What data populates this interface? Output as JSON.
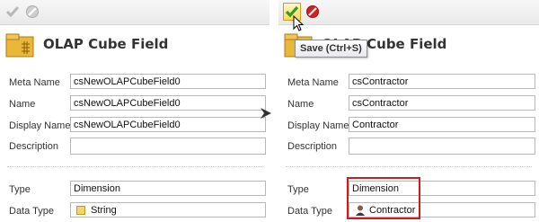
{
  "left": {
    "title": "OLAP Cube Field",
    "fields": [
      {
        "label": "Meta Name",
        "value": "csNewOLAPCubeField0"
      },
      {
        "label": "Name",
        "value": "csNewOLAPCubeField0"
      },
      {
        "label": "Display Name",
        "value": "csNewOLAPCubeField0"
      },
      {
        "label": "Description",
        "value": ""
      }
    ],
    "type_label": "Type",
    "type_value": "Dimension",
    "datatype_label": "Data Type",
    "datatype_value": "String"
  },
  "right": {
    "title": "OLAP Cube Field",
    "tooltip": "Save (Ctrl+S)",
    "fields": [
      {
        "label": "Meta Name",
        "value": "csContractor"
      },
      {
        "label": "Name",
        "value": "csContractor"
      },
      {
        "label": "Display Name",
        "value": "Contractor"
      },
      {
        "label": "Description",
        "value": ""
      }
    ],
    "type_label": "Type",
    "type_value": "Dimension",
    "datatype_label": "Data Type",
    "datatype_value": "Contractor"
  },
  "colors": {
    "save_green": "#3a9b1e",
    "cancel_red": "#d42020",
    "highlight": "#d41919"
  },
  "icons": [
    "save-check-icon",
    "cancel-icon",
    "cube-icon",
    "arrow-right-icon",
    "string-type-icon",
    "contractor-type-icon",
    "mouse-cursor-icon"
  ]
}
